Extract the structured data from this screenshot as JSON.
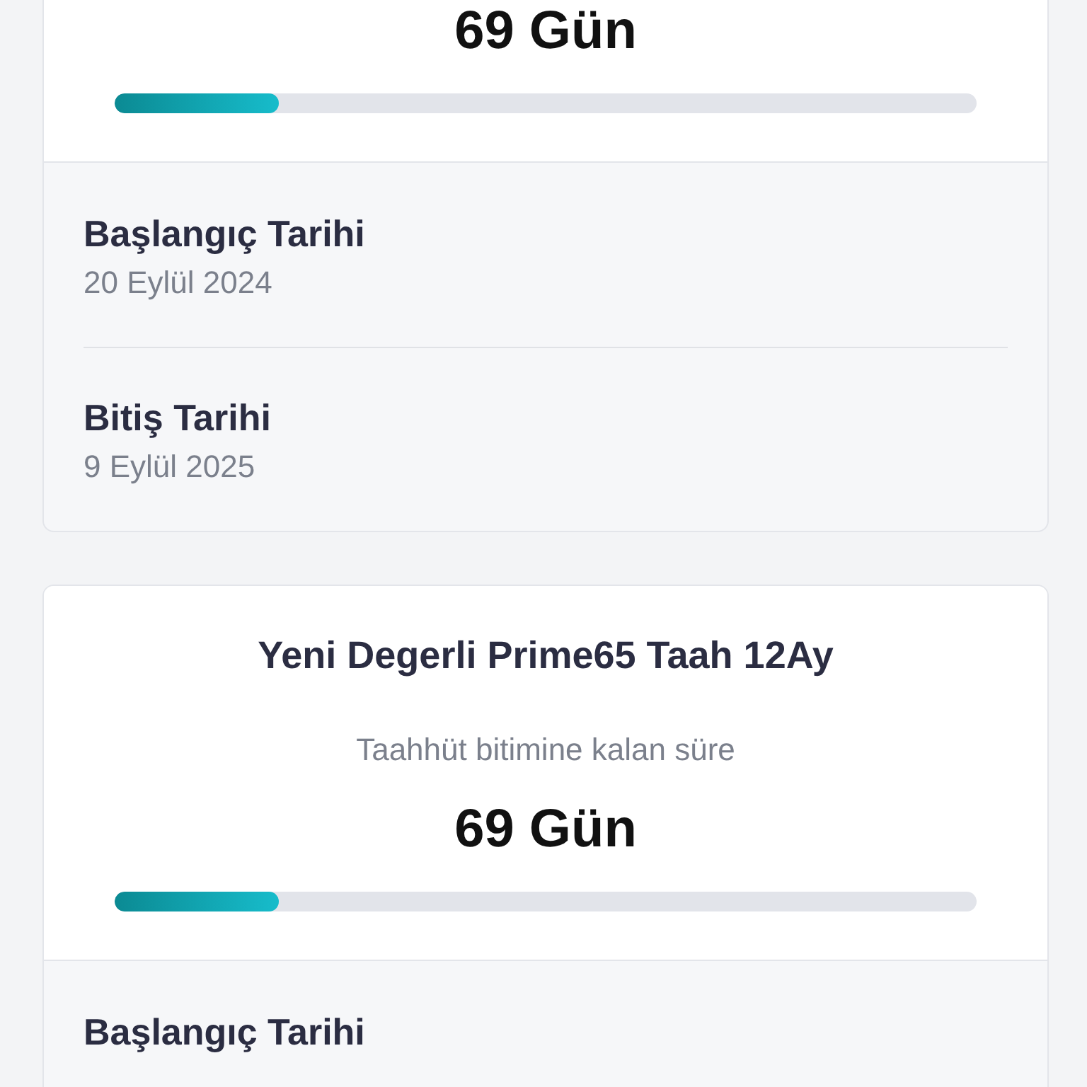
{
  "cards": [
    {
      "remaining": "69 Gün",
      "level": 0.19,
      "dates": [
        {
          "label": "Başlangıç Tarihi",
          "value": "20 Eylül 2024"
        },
        {
          "label": "Bitiş Tarihi",
          "value": "9 Eylül 2025"
        }
      ]
    },
    {
      "title": "Yeni Degerli Prime65 Taah 12Ay",
      "subtitle": "Taahhüt bitimine kalan süre",
      "remaining": "69 Gün",
      "level": 0.19,
      "dates": [
        {
          "label": "Başlangıç Tarihi"
        }
      ]
    }
  ]
}
